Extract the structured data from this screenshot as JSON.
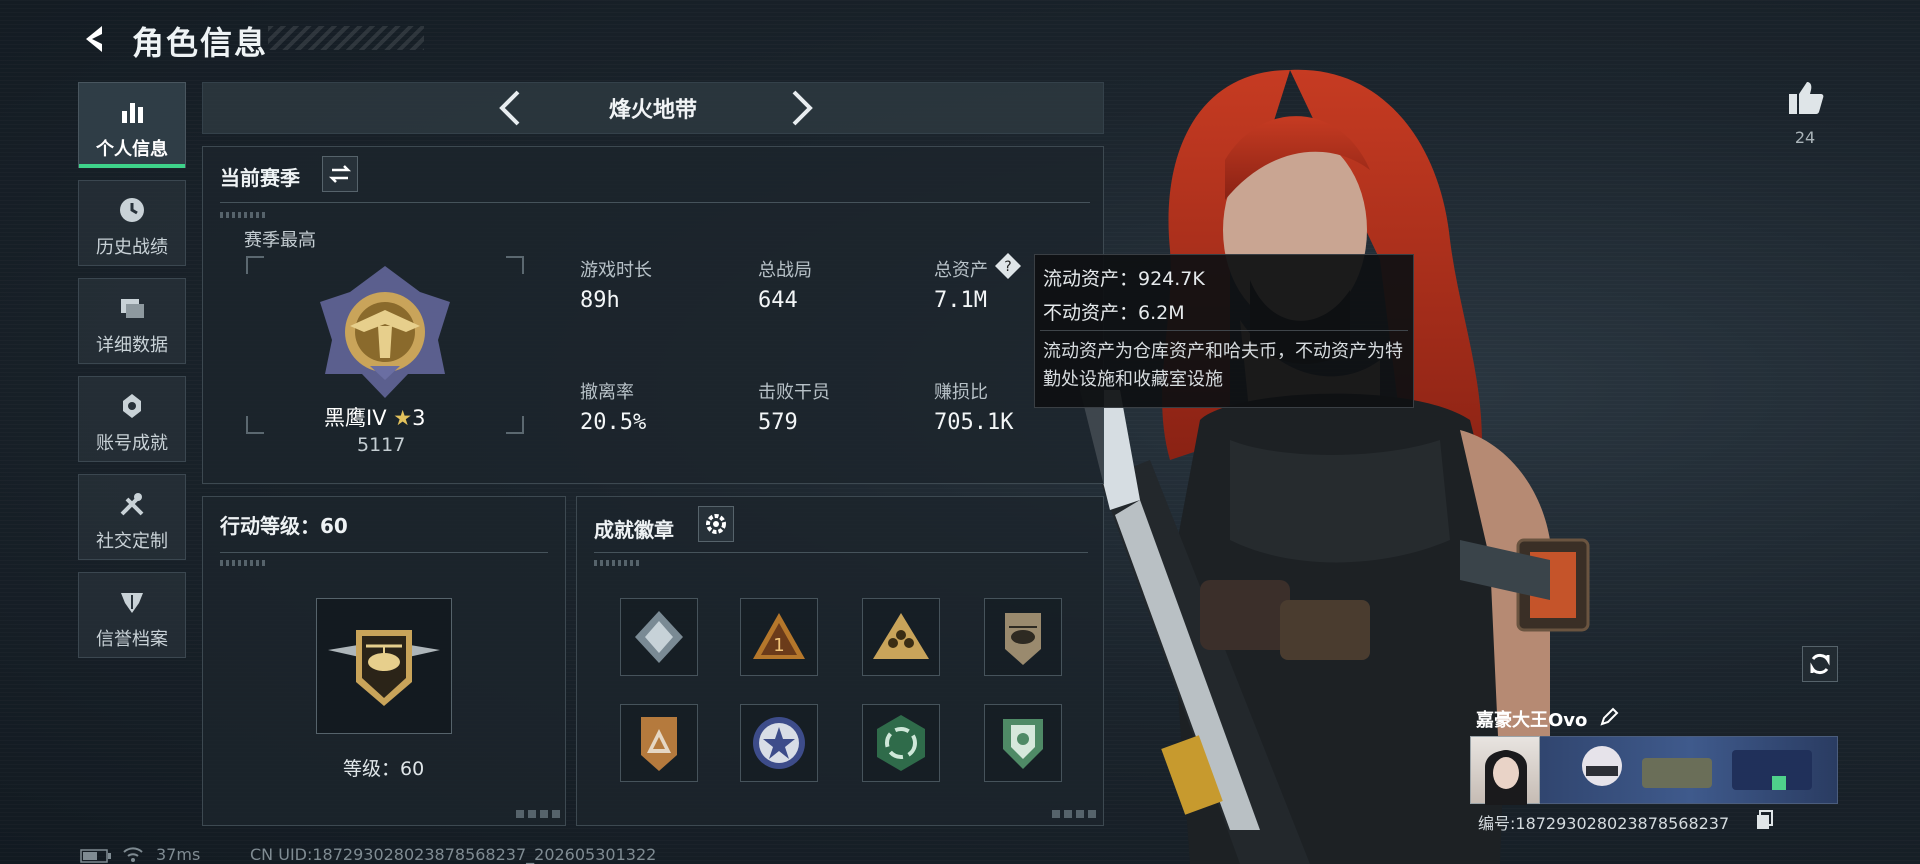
{
  "header": {
    "title": "角色信息"
  },
  "nav": {
    "items": [
      {
        "label": "个人信息",
        "icon": "bar-chart-icon",
        "active": true
      },
      {
        "label": "历史战绩",
        "icon": "clock-icon"
      },
      {
        "label": "详细数据",
        "icon": "folders-icon"
      },
      {
        "label": "账号成就",
        "icon": "medal-icon"
      },
      {
        "label": "社交定制",
        "icon": "tools-icon"
      },
      {
        "label": "信誉档案",
        "icon": "shield-icon"
      }
    ]
  },
  "mode": {
    "label": "烽火地带"
  },
  "season": {
    "title": "当前赛季",
    "best_label": "赛季最高",
    "rank_name": "黑鹰IV",
    "rank_stars": "3",
    "rank_points": "5117",
    "stats": [
      {
        "label": "游戏时长",
        "value": "89h"
      },
      {
        "label": "总战局",
        "value": "644"
      },
      {
        "label": "总资产",
        "value": "7.1M"
      },
      {
        "label": "撤离率",
        "value": "20.5%"
      },
      {
        "label": "击败干员",
        "value": "579"
      },
      {
        "label": "赚损比",
        "value": "705.1K"
      }
    ]
  },
  "tooltip": {
    "liquid": "流动资产：924.7K",
    "fixed": "不动资产：6.2M",
    "desc": "流动资产为仓库资产和哈夫币，不动资产为特勤处设施和收藏室设施"
  },
  "level": {
    "title": "行动等级：60",
    "label": "等级：60"
  },
  "achievements": {
    "title": "成就徽章",
    "badges": [
      "diamond-badge-icon",
      "rank-one-badge-icon",
      "squad-badge-icon",
      "helicopter-badge-icon",
      "triangle-badge-icon",
      "star-badge-icon",
      "cycle-badge-icon",
      "shield-badge-icon"
    ]
  },
  "player": {
    "name": "嘉豪大王Ovo",
    "id": "编号:187293028023878568237",
    "likes": "24"
  },
  "footer": {
    "ping": "37ms",
    "uid": "CN UID:187293028023878568237_202605301322"
  },
  "colors": {
    "accent": "#3ed38a",
    "hair": "#b8321f"
  }
}
